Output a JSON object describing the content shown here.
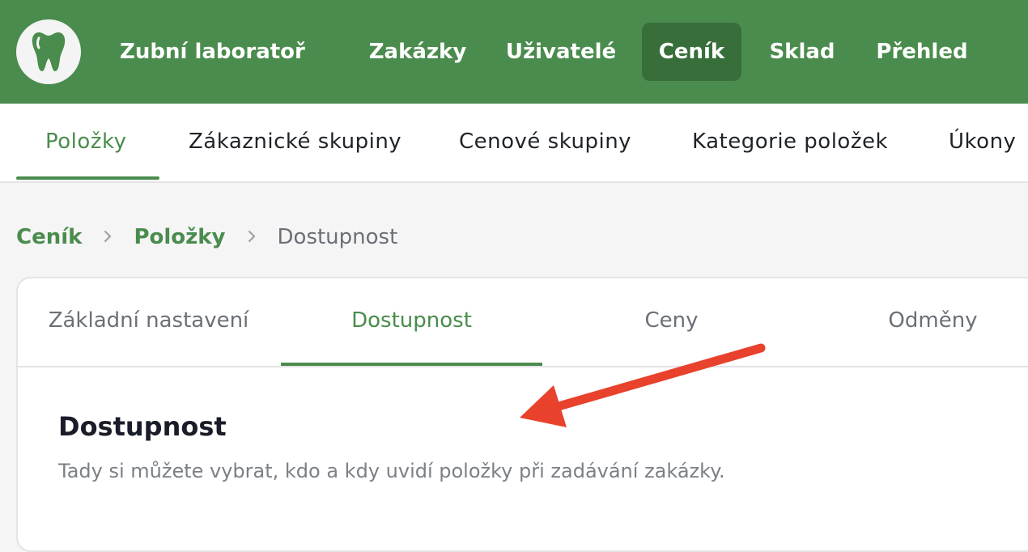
{
  "header": {
    "app_title": "Zubní laboratoř",
    "logo_icon": "tooth-icon",
    "nav": [
      {
        "label": "Zakázky",
        "active": false
      },
      {
        "label": "Uživatelé",
        "active": false
      },
      {
        "label": "Ceník",
        "active": true
      },
      {
        "label": "Sklad",
        "active": false
      },
      {
        "label": "Přehled",
        "active": false
      }
    ]
  },
  "subnav": {
    "tabs": [
      {
        "label": "Položky",
        "active": true
      },
      {
        "label": "Zákaznické skupiny",
        "active": false
      },
      {
        "label": "Cenové skupiny",
        "active": false
      },
      {
        "label": "Kategorie položek",
        "active": false
      },
      {
        "label": "Úkony",
        "active": false
      }
    ]
  },
  "breadcrumb": {
    "items": [
      "Ceník",
      "Položky"
    ],
    "current": "Dostupnost",
    "separator_icon": "chevron-right-icon"
  },
  "card": {
    "tabs": [
      {
        "label": "Základní nastavení",
        "active": false
      },
      {
        "label": "Dostupnost",
        "active": true
      },
      {
        "label": "Ceny",
        "active": false
      },
      {
        "label": "Odměny",
        "active": false
      }
    ],
    "section_title": "Dostupnost",
    "section_description": "Tady si můžete vybrat, kdo a kdy uvidí položky při zadávání zakázky."
  },
  "colors": {
    "brand_green": "#4a8c4d",
    "active_nav_bg": "#376e3a",
    "annotation_arrow": "#e8412c"
  }
}
